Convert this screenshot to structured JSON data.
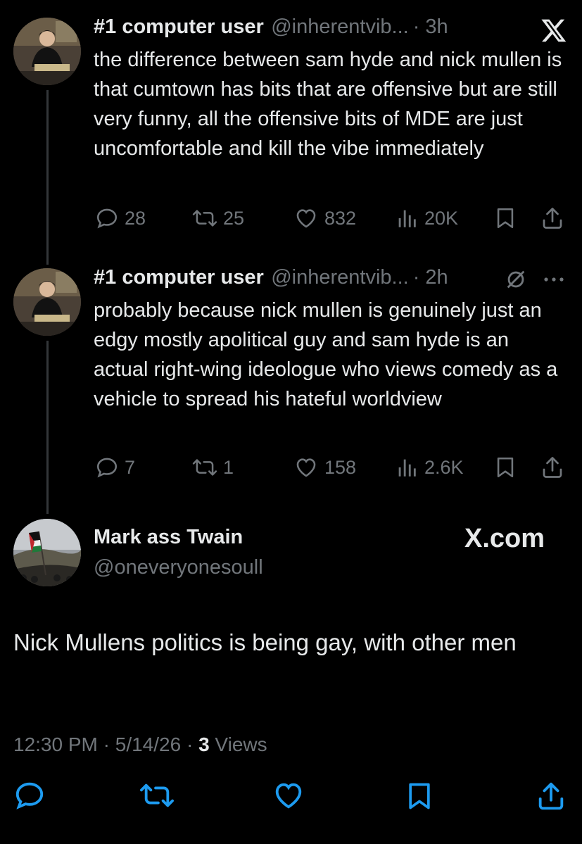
{
  "tweets": [
    {
      "name": "#1 computer user",
      "handle": "@inherentvib...",
      "time": "· 3h",
      "text": "the difference between sam hyde and nick mullen is that cumtown has bits that are offensive but are still very funny, all the offensive bits of MDE are just uncomfortable and kill the vibe immediately",
      "replies": "28",
      "retweets": "25",
      "likes": "832",
      "views": "20K"
    },
    {
      "name": "#1 computer user",
      "handle": "@inherentvib...",
      "time": "· 2h",
      "text": "probably because nick mullen is genuinely just an edgy mostly apolitical guy and sam hyde is an actual right-wing ideologue who views comedy as a vehicle to spread his hateful worldview",
      "replies": "7",
      "retweets": "1",
      "likes": "158",
      "views": "2.6K"
    }
  ],
  "top_right": {
    "icon": "x-logo-icon"
  },
  "main_tweet": {
    "name": "Mark ass Twain",
    "handle": "@oneveryonesoull",
    "watermark": "X.com",
    "text": "Nick Mullens politics is being gay, with other men",
    "time": "12:30 PM",
    "date": "5/14/26",
    "views_count": "3",
    "views_label": "Views"
  },
  "colors": {
    "background": "#000000",
    "primary_text": "#e7e9ea",
    "secondary_text": "#71767b",
    "thread_line": "#333639"
  }
}
